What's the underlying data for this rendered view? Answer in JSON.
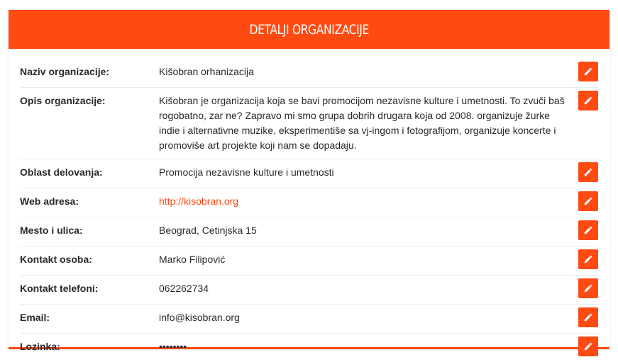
{
  "header": {
    "title": "Detalji organizacije"
  },
  "accent_color": "#ff4a12",
  "fields": [
    {
      "label": "Naziv organizacije:",
      "value": "Kišobran orhanizacija"
    },
    {
      "label": "Opis organizacije:",
      "value": "Kišobran je organizacija koja se bavi promocijom nezavisne kulture i umetnosti. To zvuči baš rogobatno, zar ne? Zapravo mi smo grupa dobrih drugara koja od 2008. organizuje žurke indie i alternativne muzike, eksperimentiše sa vj-ingom i fotografijom, organizuje koncerte i promoviše art projekte koji nam se dopadaju."
    },
    {
      "label": "Oblast delovanja:",
      "value": "Promocija nezavisne kulture i umetnosti"
    },
    {
      "label": "Web adresa:",
      "value": "http://kisobran.org"
    },
    {
      "label": "Mesto i ulica:",
      "value": "Beograd, Cetinjska 15"
    },
    {
      "label": "Kontakt osoba:",
      "value": "Marko Filipović"
    },
    {
      "label": "Kontakt telefoni:",
      "value": "062262734"
    },
    {
      "label": "Email:",
      "value": "info@kisobran.org"
    },
    {
      "label": "Lozinka:",
      "value": "••••••••"
    }
  ],
  "icons": {
    "edit": "pencil-icon"
  }
}
